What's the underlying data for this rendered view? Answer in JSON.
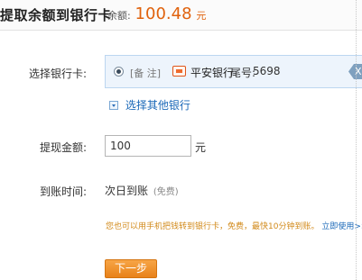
{
  "header": {
    "title": "提取余额到银行卡",
    "balance_label": "余额:",
    "balance_amount": "100.48",
    "balance_unit": "元"
  },
  "form": {
    "card_label": "选择银行卡:",
    "card": {
      "remark": "[备 注]",
      "bank_name": "平安银行",
      "tail_label": "尾号:",
      "tail_number": "5698",
      "tag_text": "X"
    },
    "other_bank_link": "选择其他银行",
    "amount_label": "提现金额:",
    "amount_value": "100",
    "amount_unit": "元",
    "arrival_label": "到账时间:",
    "arrival_value": "次日到账",
    "arrival_note": "(免费)"
  },
  "tip": {
    "text": "您也可以用手机把钱转到银行卡，免费，最快10分钟到账。",
    "link": "立即使用>>"
  },
  "next_button": "下一步",
  "colors": {
    "accent": "#e0620d",
    "link": "#1a68b8",
    "button": "#f39a33",
    "tip": "#d28a1a"
  }
}
